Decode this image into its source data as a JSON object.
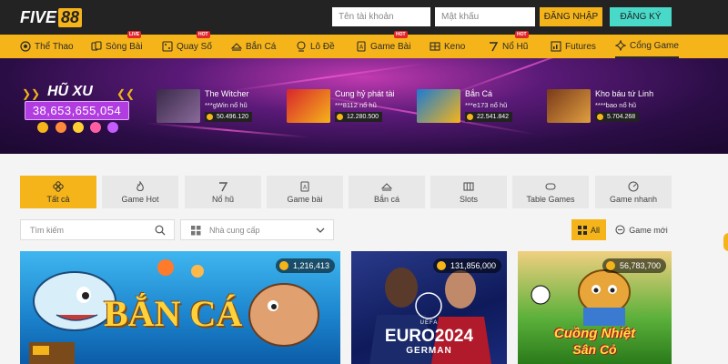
{
  "brand": {
    "logo_five": "FIVE",
    "logo_88": "88"
  },
  "login": {
    "username_placeholder": "Tên tài khoản",
    "password_placeholder": "Mật khẩu",
    "login_label": "ĐĂNG NHẬP",
    "register_label": "ĐĂNG KÝ"
  },
  "nav": {
    "items": [
      {
        "label": "Thể Thao",
        "icon": "soccer-ball-icon"
      },
      {
        "label": "Sòng Bài",
        "icon": "cards-icon",
        "badge": "LIVE"
      },
      {
        "label": "Quay Số",
        "icon": "lottery-icon",
        "badge": "HOT"
      },
      {
        "label": "Bắn Cá",
        "icon": "fish-icon"
      },
      {
        "label": "Lô Đề",
        "icon": "lotto-balls-icon"
      },
      {
        "label": "Game Bài",
        "icon": "card-game-icon",
        "badge": "HOT"
      },
      {
        "label": "Keno",
        "icon": "keno-icon"
      },
      {
        "label": "Nổ Hũ",
        "icon": "slot-icon",
        "badge": "HOT"
      },
      {
        "label": "Futures",
        "icon": "chart-icon"
      },
      {
        "label": "Cổng Game",
        "icon": "gamepad-icon"
      }
    ]
  },
  "jackpot": {
    "title": "HŨ XU",
    "value": "38,653,655,054",
    "recent": [
      {
        "game": "The Witcher",
        "user": "***gWin nổ hũ",
        "amount": "50.496.120"
      },
      {
        "game": "Cung hỷ phát tài",
        "user": "***8112 nổ hũ",
        "amount": "12.280.500"
      },
      {
        "game": "Bắn Cá",
        "user": "***e173 nổ hũ",
        "amount": "22.541.842"
      },
      {
        "game": "Kho báu tứ Linh",
        "user": "****bao nổ hũ",
        "amount": "5.704.268"
      }
    ]
  },
  "categories": {
    "tabs": [
      {
        "label": "Tất cả",
        "icon": "clover-icon"
      },
      {
        "label": "Game Hot",
        "icon": "flame-icon"
      },
      {
        "label": "Nổ hũ",
        "icon": "seven-icon"
      },
      {
        "label": "Game bài",
        "icon": "card-game-icon"
      },
      {
        "label": "Bắn cá",
        "icon": "fish-icon"
      },
      {
        "label": "Slots",
        "icon": "slot-machine-icon"
      },
      {
        "label": "Table Games",
        "icon": "table-icon"
      },
      {
        "label": "Game nhanh",
        "icon": "speed-icon"
      }
    ]
  },
  "filters": {
    "search_placeholder": "Tìm kiếm",
    "provider_label": "Nhà cung cấp",
    "all_label": "All",
    "new_label": "Game mới"
  },
  "games": [
    {
      "title_line1": "BẮN CÁ",
      "jackpot": "1,216,413"
    },
    {
      "title_line1": "EURO2024",
      "title_line2": "GERMAN",
      "top_text": "UEFA",
      "jackpot": "131,856,000"
    },
    {
      "title_line1": "Cuồng Nhiệt",
      "title_line2": "Sân Cỏ",
      "jackpot": "56,783,700"
    }
  ],
  "colors": {
    "accent": "#f5b41a",
    "register": "#48d9c8",
    "topbar": "#232323",
    "hu_value_bg": "#b13ce0"
  }
}
